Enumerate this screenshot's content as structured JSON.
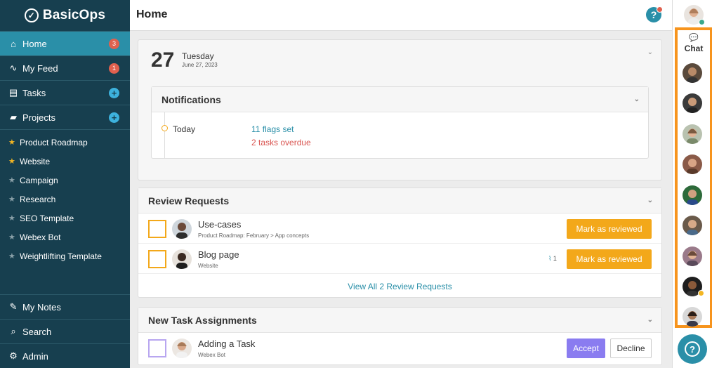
{
  "app": {
    "name": "BasicOps"
  },
  "sidebar": {
    "nav": [
      {
        "label": "Home",
        "icon": "home-icon",
        "badge": "3"
      },
      {
        "label": "My Feed",
        "icon": "activity-icon",
        "badge": "1"
      },
      {
        "label": "Tasks",
        "icon": "clipboard-icon"
      },
      {
        "label": "Projects",
        "icon": "folder-icon"
      }
    ],
    "projects": [
      {
        "label": "Product Roadmap",
        "starred": true
      },
      {
        "label": "Website",
        "starred": true
      },
      {
        "label": "Campaign",
        "starred": false
      },
      {
        "label": "Research",
        "starred": false
      },
      {
        "label": "SEO Template",
        "starred": false
      },
      {
        "label": "Webex Bot",
        "starred": false
      },
      {
        "label": "Weightlifting Template",
        "starred": false
      }
    ],
    "bottom": [
      {
        "label": "My Notes",
        "icon": "pencil-icon"
      },
      {
        "label": "Search",
        "icon": "search-icon"
      },
      {
        "label": "Admin",
        "icon": "gear-icon"
      }
    ]
  },
  "header": {
    "title": "Home",
    "help": "?"
  },
  "today": {
    "day_number": "27",
    "day_name": "Tuesday",
    "date": "June 27, 2023",
    "notifications": {
      "title": "Notifications",
      "when": "Today",
      "flags": "11 flags set",
      "overdue": "2 tasks overdue"
    }
  },
  "review": {
    "title": "Review Requests",
    "rows": [
      {
        "title": "Use-cases",
        "sub": "Product Roadmap: February  >  App concepts",
        "action": "Mark as reviewed"
      },
      {
        "title": "Blog page",
        "sub": "Website",
        "attachments": "1",
        "action": "Mark as reviewed"
      }
    ],
    "view_all": "View All 2 Review Requests"
  },
  "assignments": {
    "title": "New Task Assignments",
    "rows": [
      {
        "title": "Adding a Task",
        "sub": "Webex Bot",
        "accept": "Accept",
        "decline": "Decline"
      }
    ]
  },
  "rail": {
    "chat_label": "Chat",
    "help": "?"
  },
  "colors": {
    "sidebar": "#173f4f",
    "active": "#2a8fa8",
    "accent_orange": "#f3a81a",
    "highlight_box": "#f7941d",
    "accept": "#8a7cf0"
  }
}
